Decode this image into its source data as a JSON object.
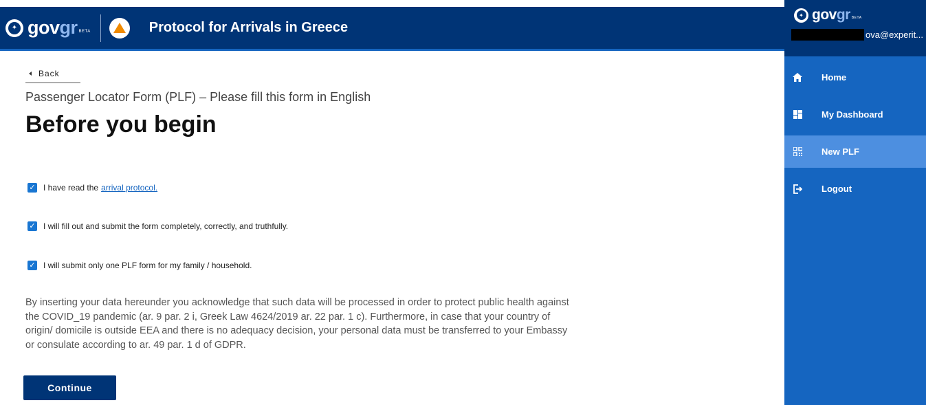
{
  "header": {
    "logo": {
      "brand": "gov",
      "brand_accent": "gr",
      "badge": "BETA"
    },
    "title": "Protocol for Arrivals in Greece"
  },
  "main": {
    "back_label": "Back",
    "form_title": "Passenger Locator Form (PLF) – Please fill this form in English",
    "heading": "Before you begin",
    "checks": [
      {
        "text": "I have read the",
        "link": "arrival protocol.",
        "checked": true
      },
      {
        "text": "I will fill out and submit the form completely, correctly, and truthfully.",
        "checked": true
      },
      {
        "text": "I will submit only one PLF form for my family / household.",
        "checked": true
      }
    ],
    "disclaimer": "By inserting your data hereunder you acknowledge that such data will be processed in order to protect public health against the COVID_19 pandemic (ar. 9 par. 2 i, Greek Law 4624/2019 ar. 22 par. 1 c). Furthermore, in case that your country of origin/ domicile is outside EEA and there is no adequacy decision, your personal data must be transferred to your Embassy or consulate according to ar. 49 par. 1 d of GDPR.",
    "continue_label": "Continue"
  },
  "drawer": {
    "logo": {
      "brand": "gov",
      "brand_accent": "gr",
      "badge": "BETA"
    },
    "user_email": "ova@experit...",
    "items": [
      {
        "label": "Home",
        "icon": "home-icon",
        "active": false
      },
      {
        "label": "My Dashboard",
        "icon": "dashboard-icon",
        "active": false
      },
      {
        "label": "New PLF",
        "icon": "qr-code-icon",
        "active": true
      },
      {
        "label": "Logout",
        "icon": "logout-icon",
        "active": false
      }
    ]
  },
  "colors": {
    "header_bg": "#003476",
    "drawer_bg": "#1565c0",
    "drawer_active": "#4d8fe0",
    "checkbox": "#1976d2",
    "link": "#1565c0",
    "button_bg": "#003476"
  }
}
